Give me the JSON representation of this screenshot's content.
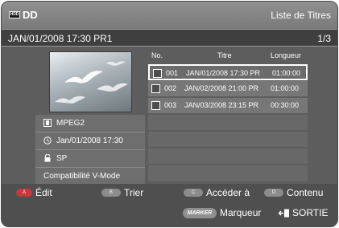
{
  "header": {
    "hdd_label": "HDD",
    "title": "DD",
    "screen_title": "Liste de Titres"
  },
  "infobar": {
    "datetime_program": "JAN/01/2008 17:30 PR1",
    "page": "1/3"
  },
  "details": {
    "format": "MPEG2",
    "date": "Jan/01/2008 17:30",
    "quality": "SP",
    "compat": "Compatibilité V-Mode"
  },
  "table": {
    "columns": {
      "no": "No.",
      "title": "Titre",
      "length": "Longueur"
    },
    "rows": [
      {
        "no": "001",
        "title": "JAN/01/2008 17:30 PR",
        "length": "01:00:00",
        "selected": true
      },
      {
        "no": "002",
        "title": "JAN/02/2008 21:00 PR",
        "length": "01:00:00",
        "selected": false
      },
      {
        "no": "003",
        "title": "JAN/03/2008 23:15 PR",
        "length": "00:30:00",
        "selected": false
      }
    ]
  },
  "footer": {
    "a": {
      "key": "A",
      "label": "Édit"
    },
    "b": {
      "key": "B",
      "label": "Trier"
    },
    "c": {
      "key": "C",
      "label": "Accéder à"
    },
    "d": {
      "key": "D",
      "label": "Contenu"
    },
    "marker": {
      "key": "MARKER",
      "label": "Marqueur"
    },
    "exit": {
      "label": "SORTIE"
    }
  },
  "colors": {
    "background": "#5d5d5d",
    "titlebar": "#858585",
    "red_key": "#c53b3b",
    "selection_border": "#ffffff"
  },
  "icons": {
    "hdd": "hdd-icon",
    "format": "film-icon",
    "date": "clock-icon",
    "quality": "lock-icon",
    "exit": "exit-icon"
  }
}
